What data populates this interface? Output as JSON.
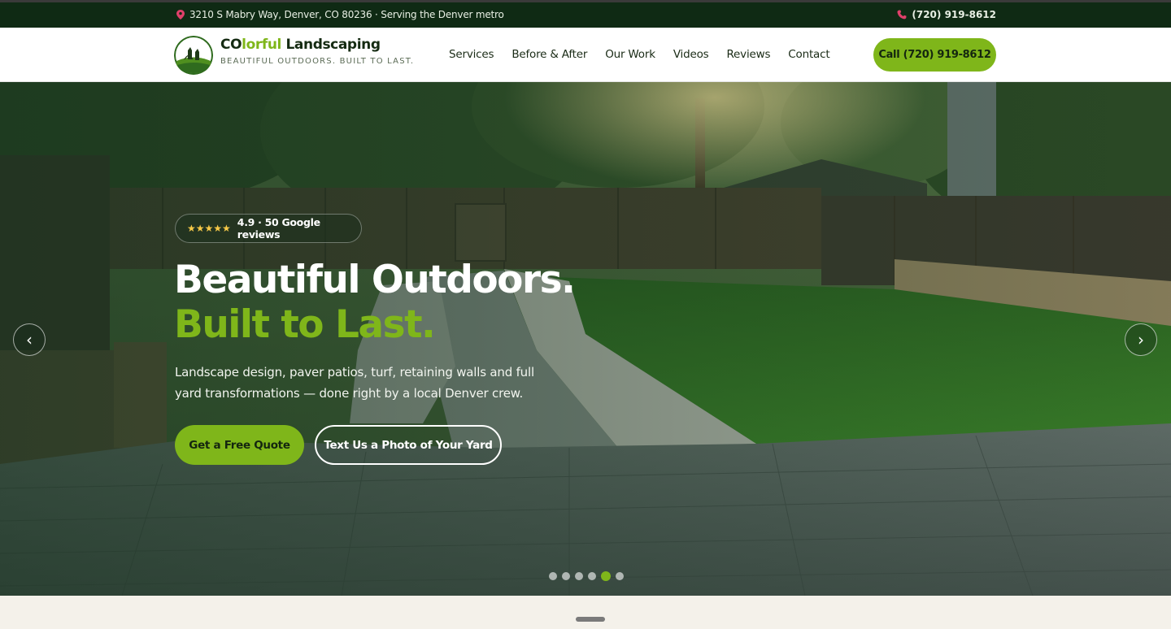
{
  "topbar": {
    "address": "3210 S Mabry Way, Denver, CO 80236 · Serving the Denver metro",
    "phone": "(720) 919-8612",
    "pin_icon": "map-pin-icon",
    "phone_icon": "phone-icon",
    "pin_color": "#e0406a",
    "phone_icon_color": "#e0406a"
  },
  "header": {
    "brand_prefix": "CO",
    "brand_accent": "lorful",
    "brand_suffix": " Landscaping",
    "tagline": "BEAUTIFUL OUTDOORS. BUILT TO LAST.",
    "nav": [
      "Services",
      "Before & After",
      "Our Work",
      "Videos",
      "Reviews",
      "Contact"
    ],
    "call_button": "Call (720) 919-8612"
  },
  "hero": {
    "stars": "★★★★★",
    "rating_text": "4.9 · 50 Google reviews",
    "title_line1": "Beautiful Outdoors.",
    "title_line2": "Built to Last.",
    "subtitle": "Landscape design, paver patios, turf, retaining walls and full yard transformations — done right by a local Denver crew.",
    "primary_cta": "Get a Free Quote",
    "secondary_cta": "Text Us a Photo of Your Yard",
    "prev_arrow": "‹",
    "next_arrow": "›",
    "slide_count": 6,
    "active_slide": 5
  },
  "colors": {
    "accent": "#7fb61a",
    "dark_green": "#0f2a14",
    "text_dark": "#152b12",
    "bottom_bg": "#f4f1ea"
  }
}
